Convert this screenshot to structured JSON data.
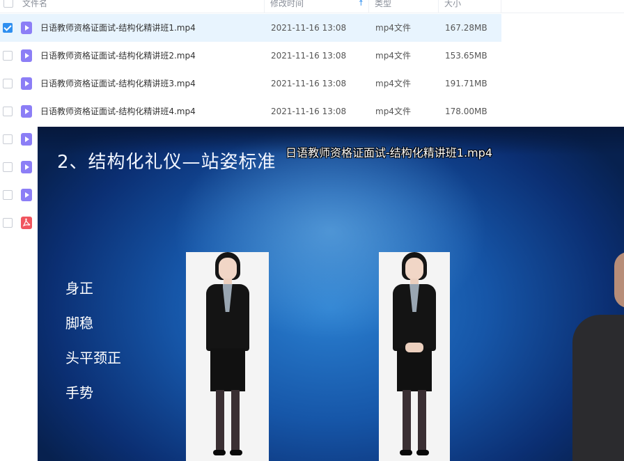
{
  "header": {
    "col_name": "文件名",
    "col_time": "修改时间",
    "col_type": "类型",
    "col_size": "大小",
    "sort_arrow": "↑"
  },
  "files": [
    {
      "name": "日语教师资格证面试-结构化精讲班1.mp4",
      "time": "2021-11-16 13:08",
      "type": "mp4文件",
      "size": "167.28MB",
      "checked": true
    },
    {
      "name": "日语教师资格证面试-结构化精讲班2.mp4",
      "time": "2021-11-16 13:08",
      "type": "mp4文件",
      "size": "153.65MB",
      "checked": false
    },
    {
      "name": "日语教师资格证面试-结构化精讲班3.mp4",
      "time": "2021-11-16 13:08",
      "type": "mp4文件",
      "size": "191.71MB",
      "checked": false
    },
    {
      "name": "日语教师资格证面试-结构化精讲班4.mp4",
      "time": "2021-11-16 13:08",
      "type": "mp4文件",
      "size": "178.00MB",
      "checked": false
    }
  ],
  "hidden_rows_icons": [
    "video-file-icon",
    "video-file-icon",
    "video-file-icon",
    "pdf-file-icon"
  ],
  "video": {
    "filename": "日语教师资格证面试-结构化精讲班1.mp4",
    "slide_heading": "2、结构化礼仪—站姿标准",
    "points": [
      "身正",
      "脚稳",
      "头平颈正",
      "手势"
    ]
  },
  "colors": {
    "accent": "#2f8ff0",
    "selected_row": "#e8f4fe",
    "video_icon": "#8c7ef6",
    "pdf_icon": "#f0555f"
  }
}
